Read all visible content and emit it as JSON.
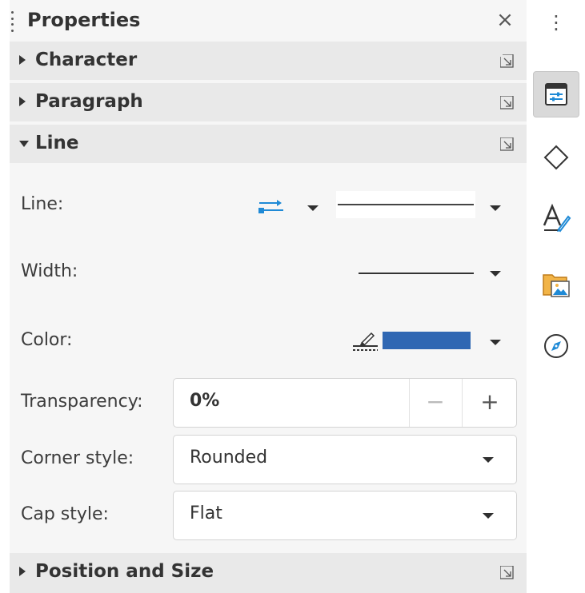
{
  "panel": {
    "title": "Properties",
    "close_label": "×"
  },
  "sections": {
    "character": {
      "label": "Character",
      "expanded": false
    },
    "paragraph": {
      "label": "Paragraph",
      "expanded": false
    },
    "line": {
      "label": "Line",
      "expanded": true
    },
    "position_size": {
      "label": "Position and Size",
      "expanded": false
    }
  },
  "line": {
    "line_label": "Line:",
    "width_label": "Width:",
    "color_label": "Color:",
    "color_value": "#2f67b3",
    "transparency_label": "Transparency:",
    "transparency_value": "0%",
    "transparency_minus": "−",
    "transparency_plus": "+",
    "corner_style_label": "Corner style:",
    "corner_style_value": "Rounded",
    "cap_style_label": "Cap style:",
    "cap_style_value": "Flat"
  },
  "tabbar": {
    "menu_label": "⋮",
    "tabs": [
      {
        "icon": "properties-icon",
        "active": true
      },
      {
        "icon": "shapes-icon",
        "active": false
      },
      {
        "icon": "styles-icon",
        "active": false
      },
      {
        "icon": "gallery-icon",
        "active": false
      },
      {
        "icon": "navigator-icon",
        "active": false
      }
    ]
  },
  "colors": {
    "accent_blue": "#2f67b3",
    "arrows_blue": "#1f8ad6",
    "panel_bg": "#f6f6f6",
    "header_bg": "#e9e9e9"
  }
}
